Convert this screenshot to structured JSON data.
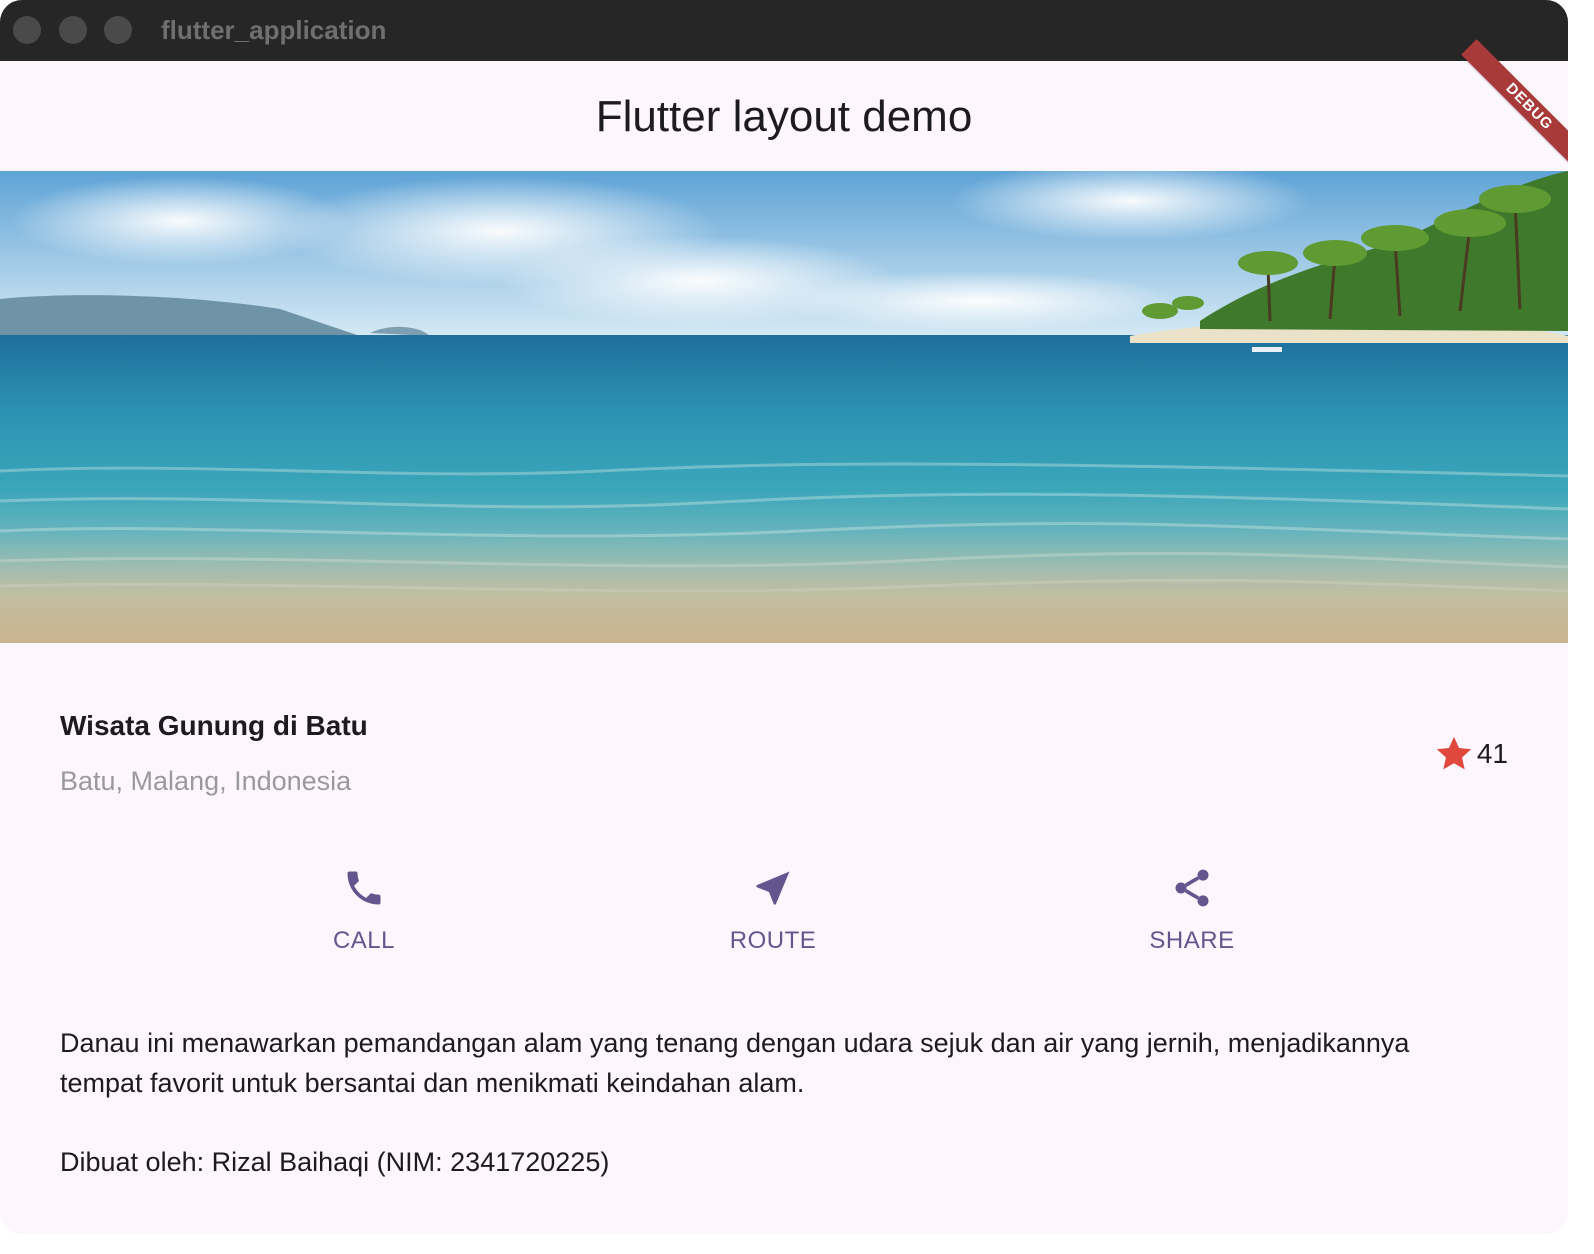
{
  "window": {
    "title": "flutter_application"
  },
  "appbar": {
    "title": "Flutter layout demo",
    "debug_banner": "DEBUG"
  },
  "place": {
    "name": "Wisata Gunung di Batu",
    "location": "Batu, Malang, Indonesia",
    "rating_count": "41",
    "star_icon": "star-icon"
  },
  "actions": [
    {
      "label": "CALL",
      "icon": "phone-icon"
    },
    {
      "label": "ROUTE",
      "icon": "navigation-icon"
    },
    {
      "label": "SHARE",
      "icon": "share-icon"
    }
  ],
  "description": {
    "text": "Danau ini menawarkan pemandangan alam yang tenang dengan udara sejuk dan air yang jernih, menjadikannya tempat favorit untuk bersantai dan menikmati keindahan alam.",
    "credit": "Dibuat oleh: Rizal Baihaqi (NIM: 2341720225)"
  },
  "colors": {
    "accent": "#65558f",
    "star": "#e0483e",
    "background": "#fdf7fd",
    "titlebar": "#262626",
    "debug": "#a83a3a"
  }
}
